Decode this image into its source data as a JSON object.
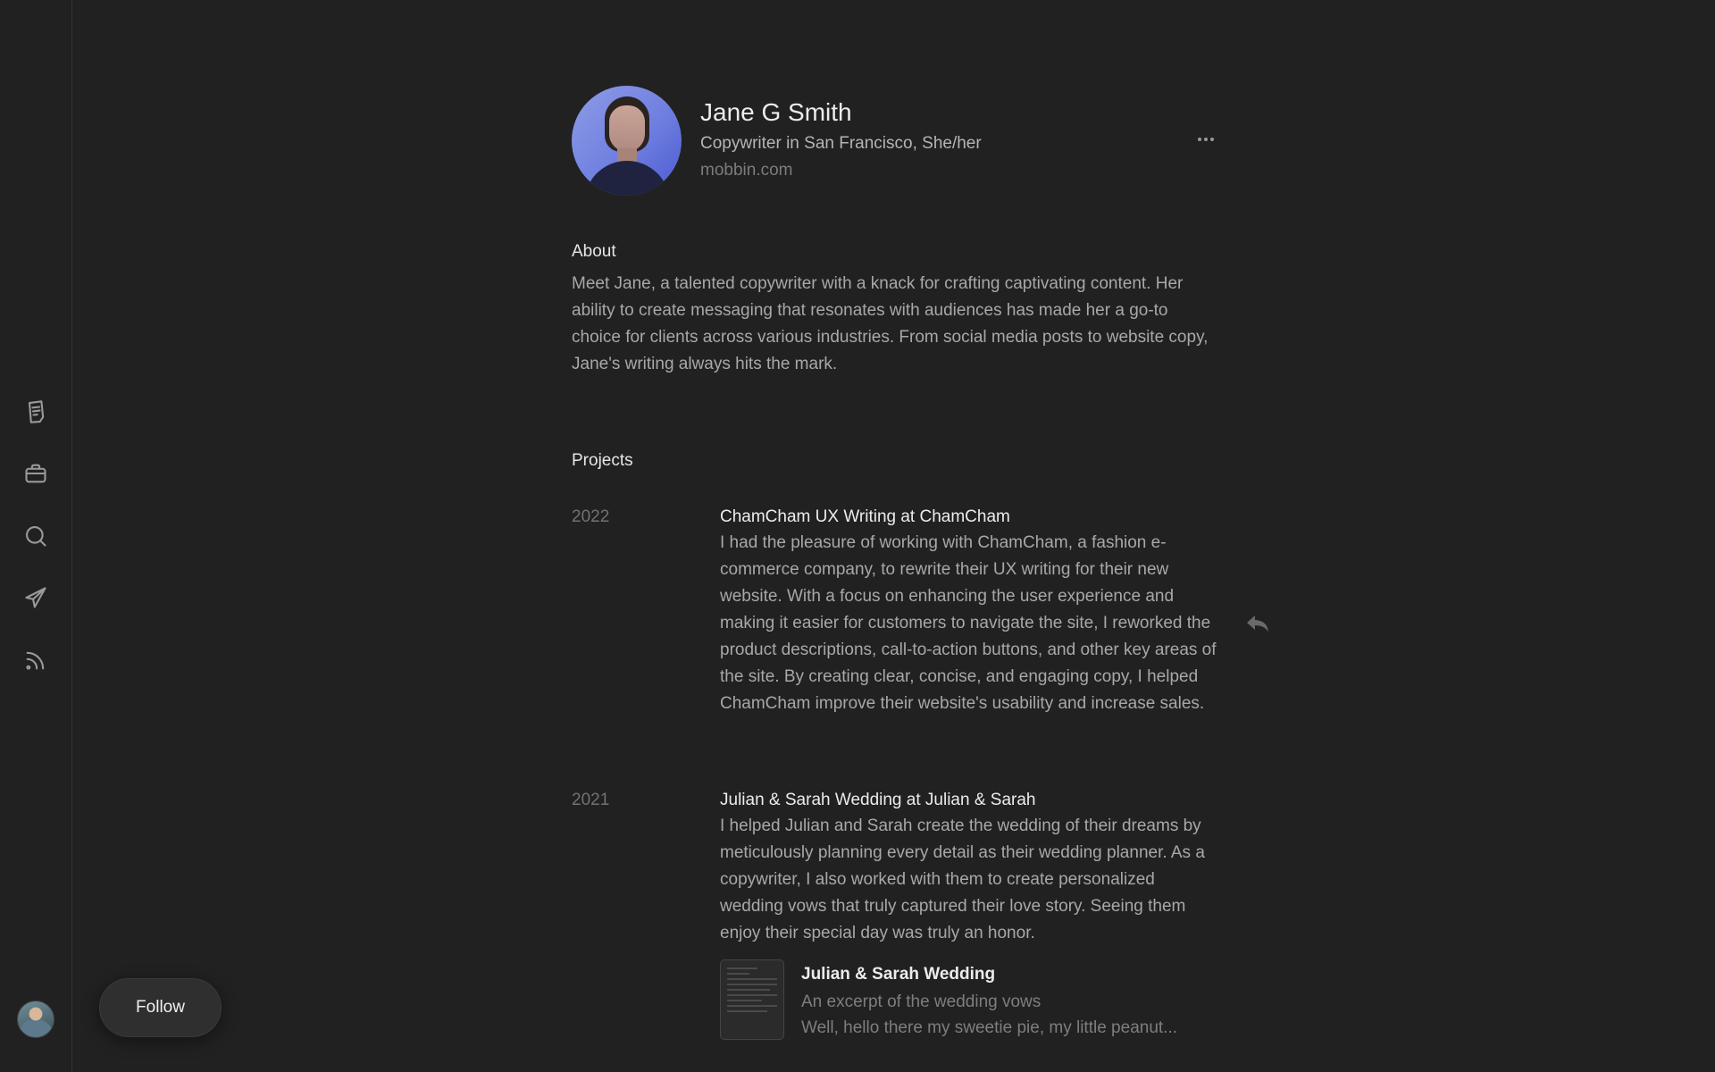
{
  "sidebar": {
    "items": [
      {
        "icon": "document-icon"
      },
      {
        "icon": "briefcase-icon"
      },
      {
        "icon": "search-icon"
      },
      {
        "icon": "send-icon"
      },
      {
        "icon": "feed-icon"
      }
    ]
  },
  "follow_label": "Follow",
  "profile": {
    "name": "Jane G Smith",
    "subtitle": "Copywriter in San Francisco, She/her",
    "website": "mobbin.com"
  },
  "about": {
    "heading": "About",
    "text": "Meet Jane, a talented copywriter with a knack for crafting captivating content. Her ability to create messaging that resonates with audiences has made her a go-to choice for clients across various industries. From social media posts to website copy, Jane's writing always hits the mark."
  },
  "projects": {
    "heading": "Projects",
    "items": [
      {
        "year": "2022",
        "title": "ChamCham UX Writing at ChamCham",
        "description": "I had the pleasure of working with ChamCham, a fashion e-commerce company, to rewrite their UX writing for their new website. With a focus on enhancing the user experience and making it easier for customers to navigate the site, I reworked the product descriptions, call-to-action buttons, and other key areas of the site. By creating clear, concise, and engaging copy, I helped ChamCham improve their website's usability and increase sales."
      },
      {
        "year": "2021",
        "title": "Julian & Sarah Wedding at Julian & Sarah",
        "description": "I helped Julian and Sarah create the wedding of their dreams by meticulously planning every detail as their wedding planner. As a copywriter, I also worked with them to create personalized wedding vows that truly captured their love story. Seeing them enjoy their special day was truly an honor.",
        "attachment": {
          "title": "Julian & Sarah Wedding",
          "subtitle": "An excerpt of the wedding vows",
          "excerpt": "Well, hello there my sweetie pie, my little peanut..."
        }
      }
    ]
  },
  "colors": {
    "background": "#212121",
    "text_primary": "#ececec",
    "text_secondary": "#a8a8a8",
    "text_muted": "#727272"
  }
}
